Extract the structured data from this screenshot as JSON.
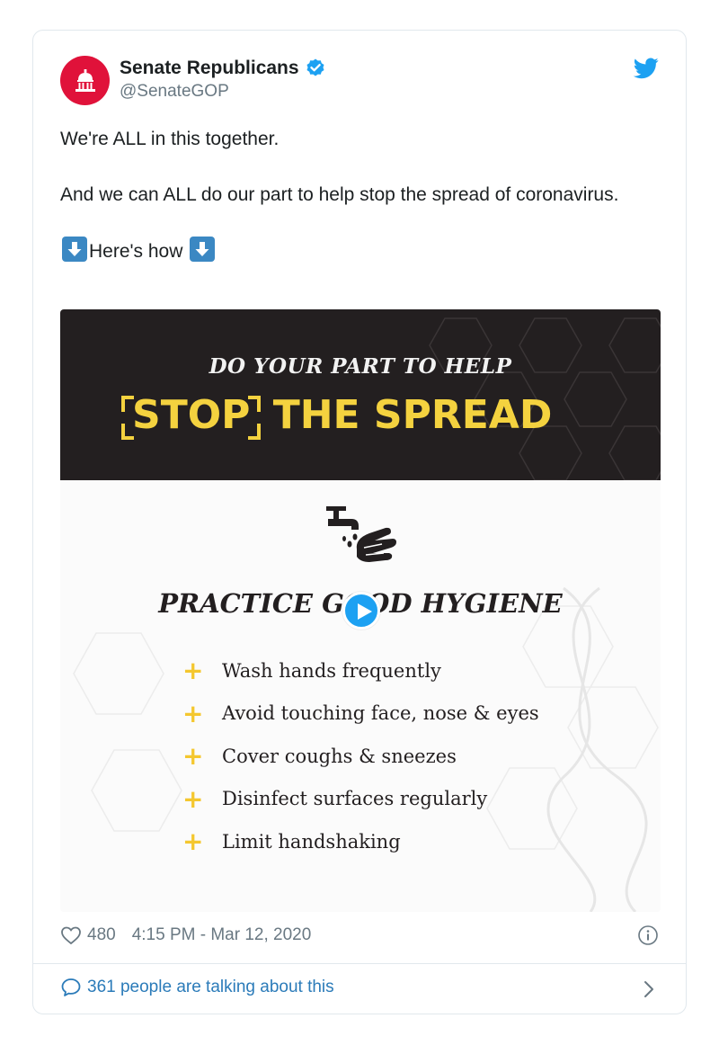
{
  "tweet": {
    "author_name": "Senate Republicans",
    "author_handle": "@SenateGOP",
    "text_line1": "We're ALL in this together.",
    "text_line2": "And we can ALL do our part to help stop the spread of coronavirus.",
    "text_line3": "Here's how",
    "likes": "480",
    "timestamp": "4:15 PM - Mar 12, 2020",
    "talking": "361 people are talking about this"
  },
  "media": {
    "banner_sub": "DO YOUR PART TO HELP",
    "banner_word1": "STOP",
    "banner_word2": "THE SPREAD",
    "section_title": "PRACTICE GOOD HYGIENE",
    "tips": [
      "Wash hands frequently",
      "Avoid touching face, nose & eyes",
      "Cover coughs & sneezes",
      "Disinfect surfaces regularly",
      "Limit handshaking"
    ]
  },
  "colors": {
    "accent": "#1da1f2",
    "avatar_bg": "#e0123a",
    "banner_bg": "#231f20",
    "banner_yellow": "#f4d23f",
    "link": "#2b7bb9"
  },
  "icons": [
    "capitol-icon",
    "verified-badge-icon",
    "twitter-bird-icon",
    "down-arrow-emoji-icon",
    "hand-washing-icon",
    "play-icon",
    "plus-icon",
    "heart-icon",
    "info-icon",
    "speech-bubble-icon",
    "chevron-right-icon"
  ]
}
